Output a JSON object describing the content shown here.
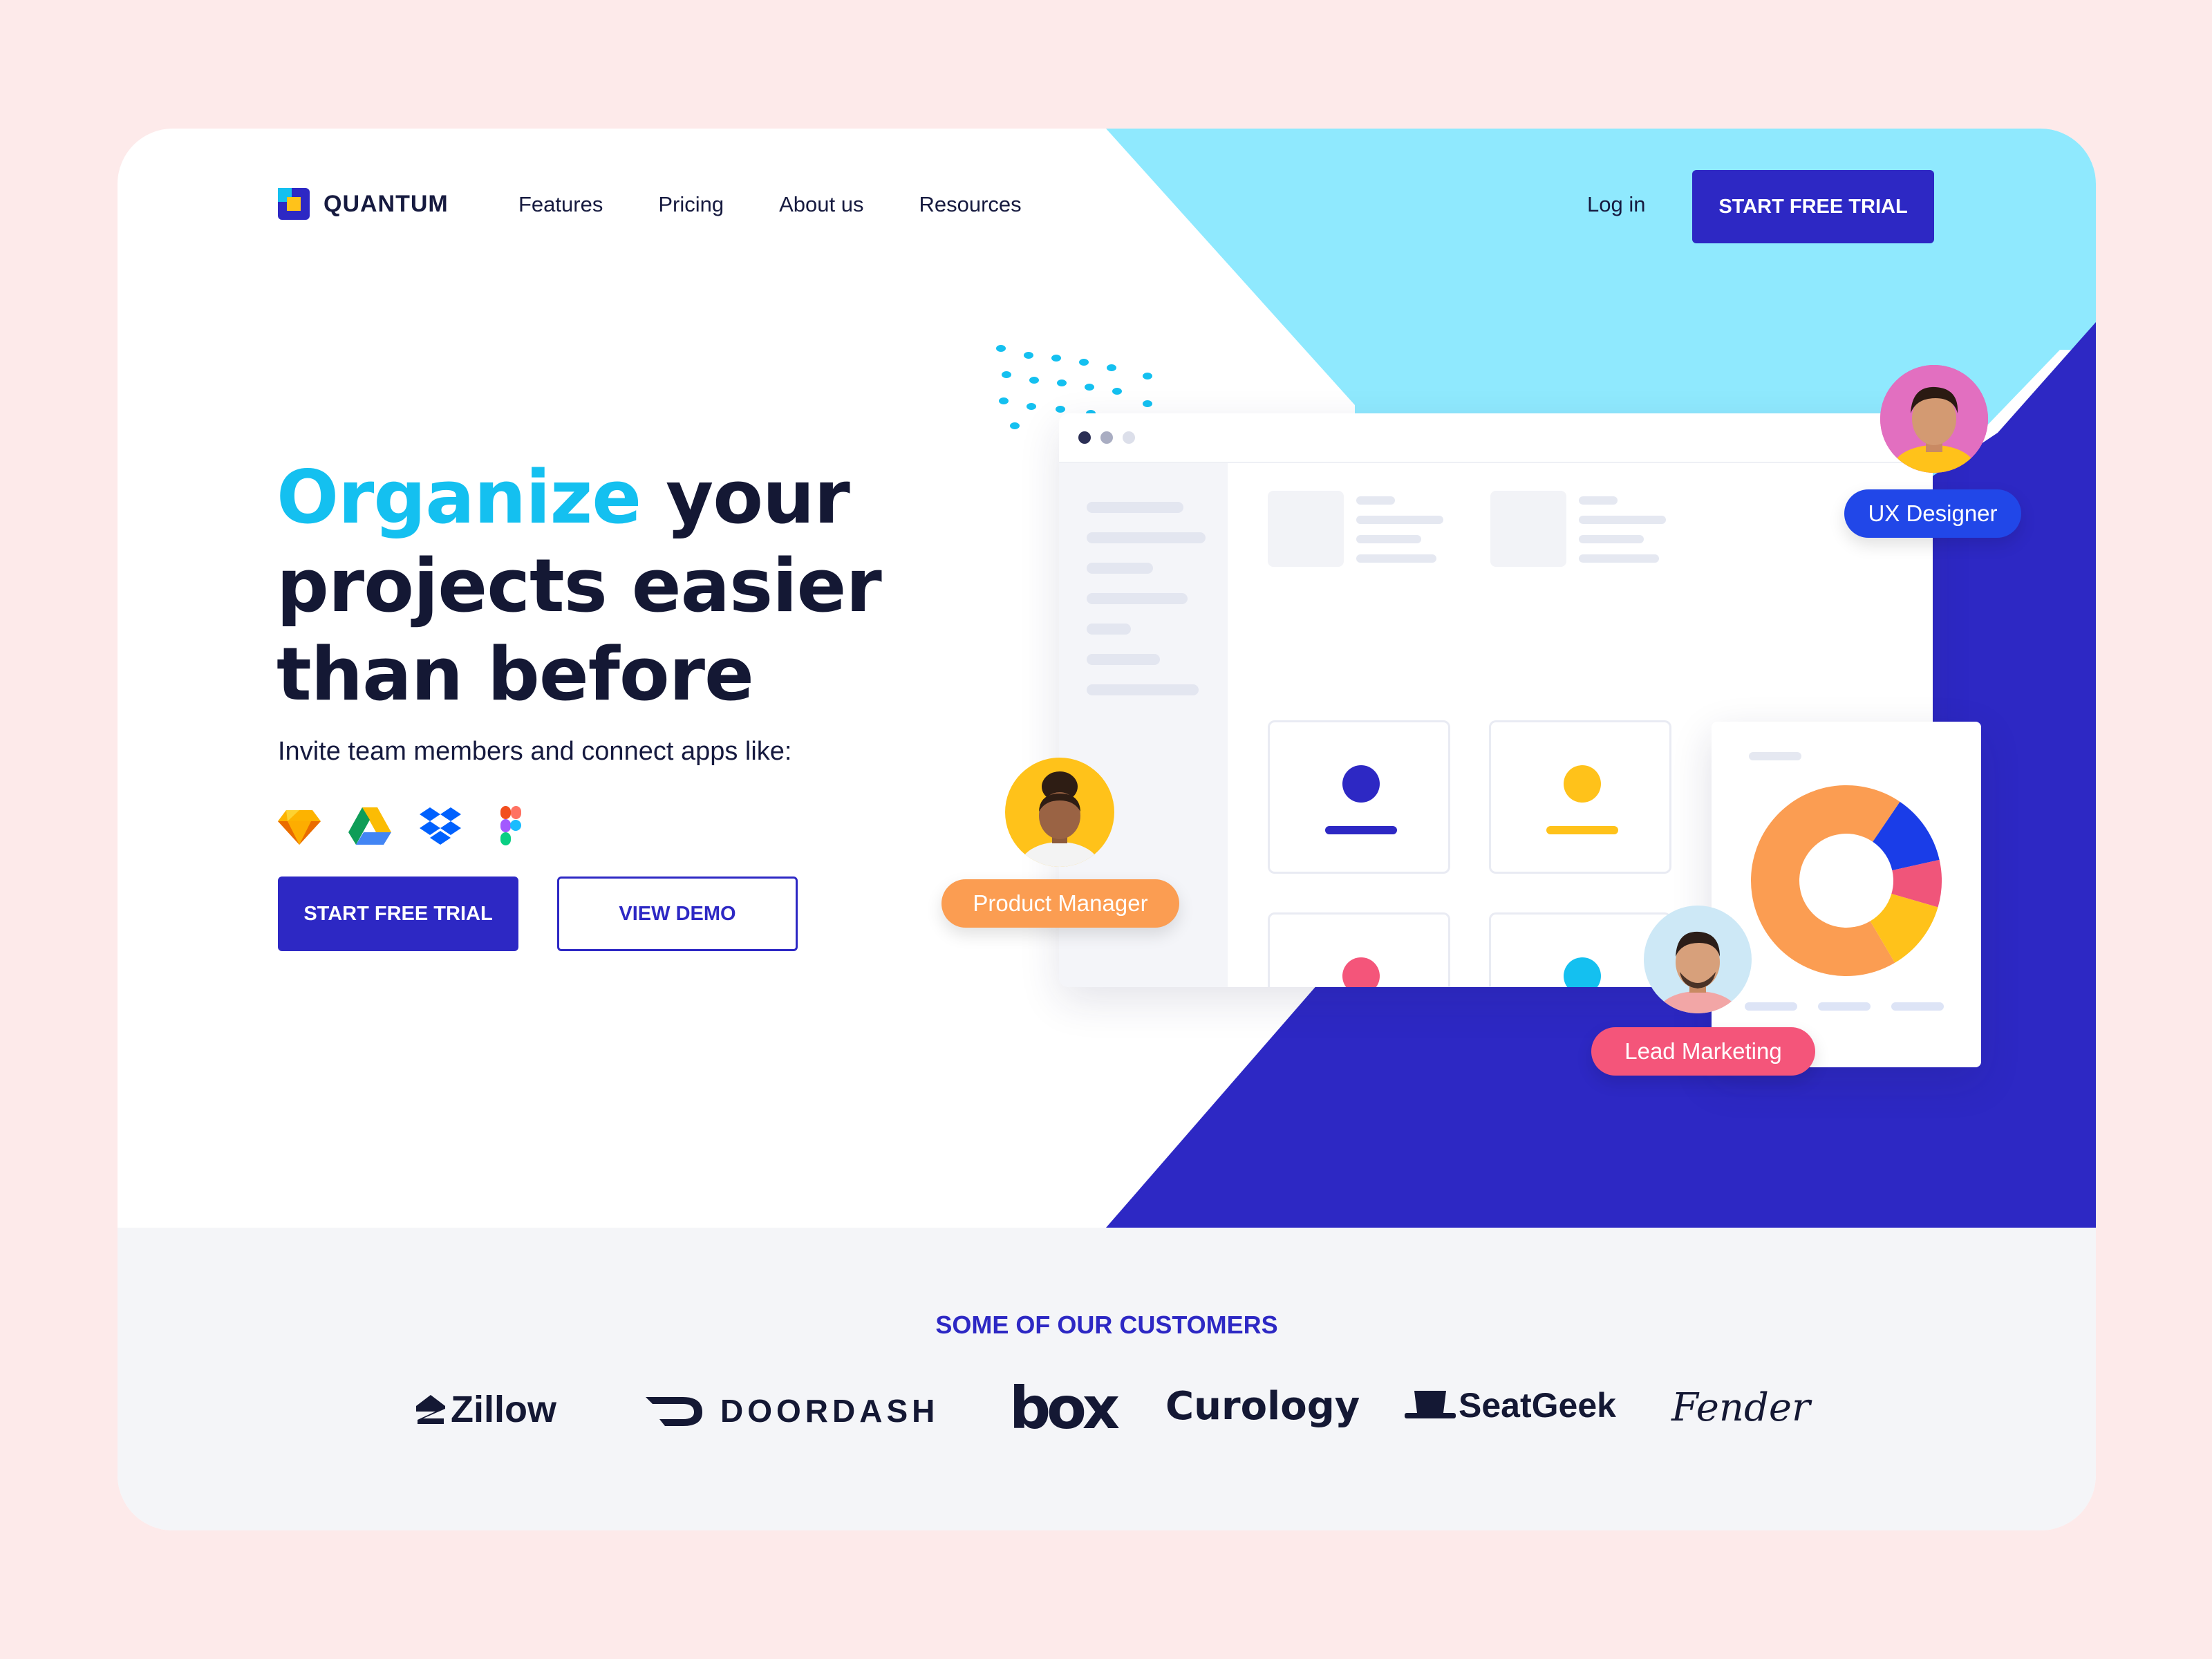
{
  "brand": {
    "name": "QUANTUM"
  },
  "nav": {
    "items": [
      "Features",
      "Pricing",
      "About us",
      "Resources"
    ],
    "login": "Log in",
    "cta": "START FREE TRIAL"
  },
  "hero": {
    "headline_accent": "Organize",
    "headline_line1_rest": " your",
    "headline_line2": "projects easier",
    "headline_line3": "than before",
    "subtitle": "Invite team members and connect apps like:",
    "apps": [
      "sketch-icon",
      "google-drive-icon",
      "dropbox-icon",
      "figma-icon"
    ],
    "primary_cta": "START FREE TRIAL",
    "secondary_cta": "VIEW DEMO"
  },
  "roles": {
    "ux": "UX Designer",
    "pm": "Product Manager",
    "lead": "Lead Marketing"
  },
  "donut": {
    "segments": [
      {
        "color": "#fb9d52",
        "value": 0.68
      },
      {
        "color": "#1a3de8",
        "value": 0.12
      },
      {
        "color": "#f0557a",
        "value": 0.08
      },
      {
        "color": "#ffc21a",
        "value": 0.12
      }
    ]
  },
  "customers": {
    "title": "SOME OF OUR CUSTOMERS",
    "logos": [
      "Zillow",
      "DOORDASH",
      "box",
      "Curology",
      "SeatGeek",
      "Fender"
    ]
  },
  "colors": {
    "brand": "#2d28c4",
    "accent": "#14c0f0",
    "cyan_shape": "#8fe9fe",
    "navy_shape": "#2d28c4"
  }
}
